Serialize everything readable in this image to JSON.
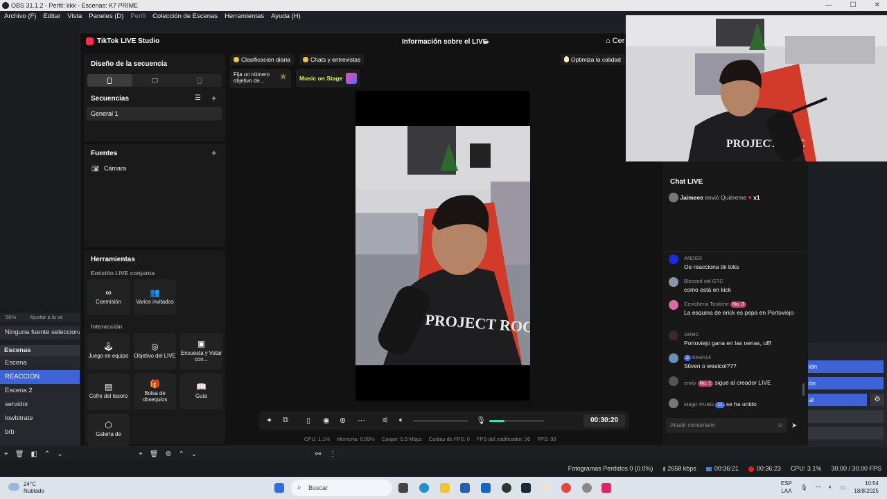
{
  "obs": {
    "title": "OBS 31.1.2 - Perfil: kkk - Escenas: K7 PRIME",
    "menu": [
      "Archivo (F)",
      "Editar",
      "Vista",
      "Paneles (D)",
      "Perfil",
      "Colección de Escenas",
      "Herramientas",
      "Ayuda (H)"
    ],
    "zoom": "56%",
    "zoom_label": "Ajustar a la ve",
    "no_source": "Ninguna fuente seleccionada",
    "scenes_title": "Escenas",
    "scenes": [
      "Escena",
      "REACCION",
      "Escena 2",
      "servidor",
      "lowbitrate",
      "brb"
    ],
    "selected_scene": "REACCION",
    "right_buttons": [
      "ión",
      "ón",
      "al"
    ],
    "status": {
      "dropped": "Fotogramas Perdidos 0 (0.0%)",
      "kbps": "2658 kbps",
      "stream_time": "00:36:21",
      "rec_time": "00:36:23",
      "cpu": "CPU: 3.1%",
      "fps": "30.00 / 30.00 FPS"
    }
  },
  "tiktok": {
    "app_title": "TikTok LIVE Studio",
    "header_center": "Información sobre el LIVE",
    "header_right": "Cer",
    "layout_title": "Diseño de la secuencia",
    "sequences_title": "Secuencias",
    "sequence_item": "General 1",
    "sources_title": "Fuentes",
    "source_item": "Cámara",
    "tools_title": "Herramientas",
    "collab_label": "Emisión LIVE conjunta",
    "collab_tools": [
      {
        "icon": "∞",
        "label": "Coemisión"
      },
      {
        "icon": "👥",
        "label": "Varios invitados"
      }
    ],
    "interaction_label": "Interacción",
    "interaction_tools": [
      {
        "icon": "🕹",
        "label": "Juego en equipo"
      },
      {
        "icon": "◎",
        "label": "Objetivo del LIVE"
      },
      {
        "icon": "▣",
        "label": "Encuesta y Votar con..."
      },
      {
        "icon": "▤",
        "label": "Cofre del tesoro"
      },
      {
        "icon": "🎁",
        "label": "Bolsa de obsequios"
      },
      {
        "icon": "📖",
        "label": "Guía"
      },
      {
        "icon": "⬡",
        "label": "Galería de"
      }
    ],
    "chips": {
      "daily": "Clasificación diaria",
      "chats": "Chats y entrevistas",
      "optimize": "Optimiza la calidad"
    },
    "goal_card": "Fija un número objetivo de...",
    "music_card": "Music on Stage",
    "timer": "00:30:20",
    "volume": 0.38,
    "mic_level": 0.28,
    "stats": [
      "CPU: 1.1%",
      "Memoria: 0.89%",
      "Cargar: 5.5 Mbps",
      "Caídas de FPS: 0",
      "FPS del codificador: 30",
      "FPS: 30"
    ]
  },
  "chat": {
    "title": "Chat LIVE",
    "gift_user": "Jaimeee",
    "gift_text": "envió Quiéreme",
    "gift_count": "x1",
    "messages": [
      {
        "user": "ANDER",
        "badge": "",
        "text": "Oe reacciona tik toks",
        "color": "#1a2bd8"
      },
      {
        "user": "Blessed old GTC",
        "badge": "",
        "text": "como está en kick",
        "color": "#8a96a8"
      },
      {
        "user": "Cevicheria Tostiche",
        "badge": "No. 3",
        "text": "La esquina de erick es pepa en Portoviejo",
        "color": "#d86aa8"
      },
      {
        "user": "ARMC",
        "badge": "",
        "text": "Portoviejo gana en las nenas, ufff",
        "color": "#3a2a2a"
      },
      {
        "user": "Kevin14",
        "badge": "2",
        "text": "Stiven o westcol???",
        "color": "#6a90b8"
      },
      {
        "user": "emily",
        "badge": "No. 1",
        "text": "sigue al creador LIVE",
        "color": "#555"
      },
      {
        "user": "Magic PUBG",
        "badge": "11",
        "text": "se ha unido",
        "color": "#777"
      }
    ],
    "input_placeholder": "Añadir comentario"
  },
  "taskbar": {
    "temp": "24°C",
    "weather": "Nublado",
    "search": "Buscar",
    "lang1": "ESP",
    "lang2": "LAA",
    "time": "10:54",
    "date": "18/8/2025"
  }
}
